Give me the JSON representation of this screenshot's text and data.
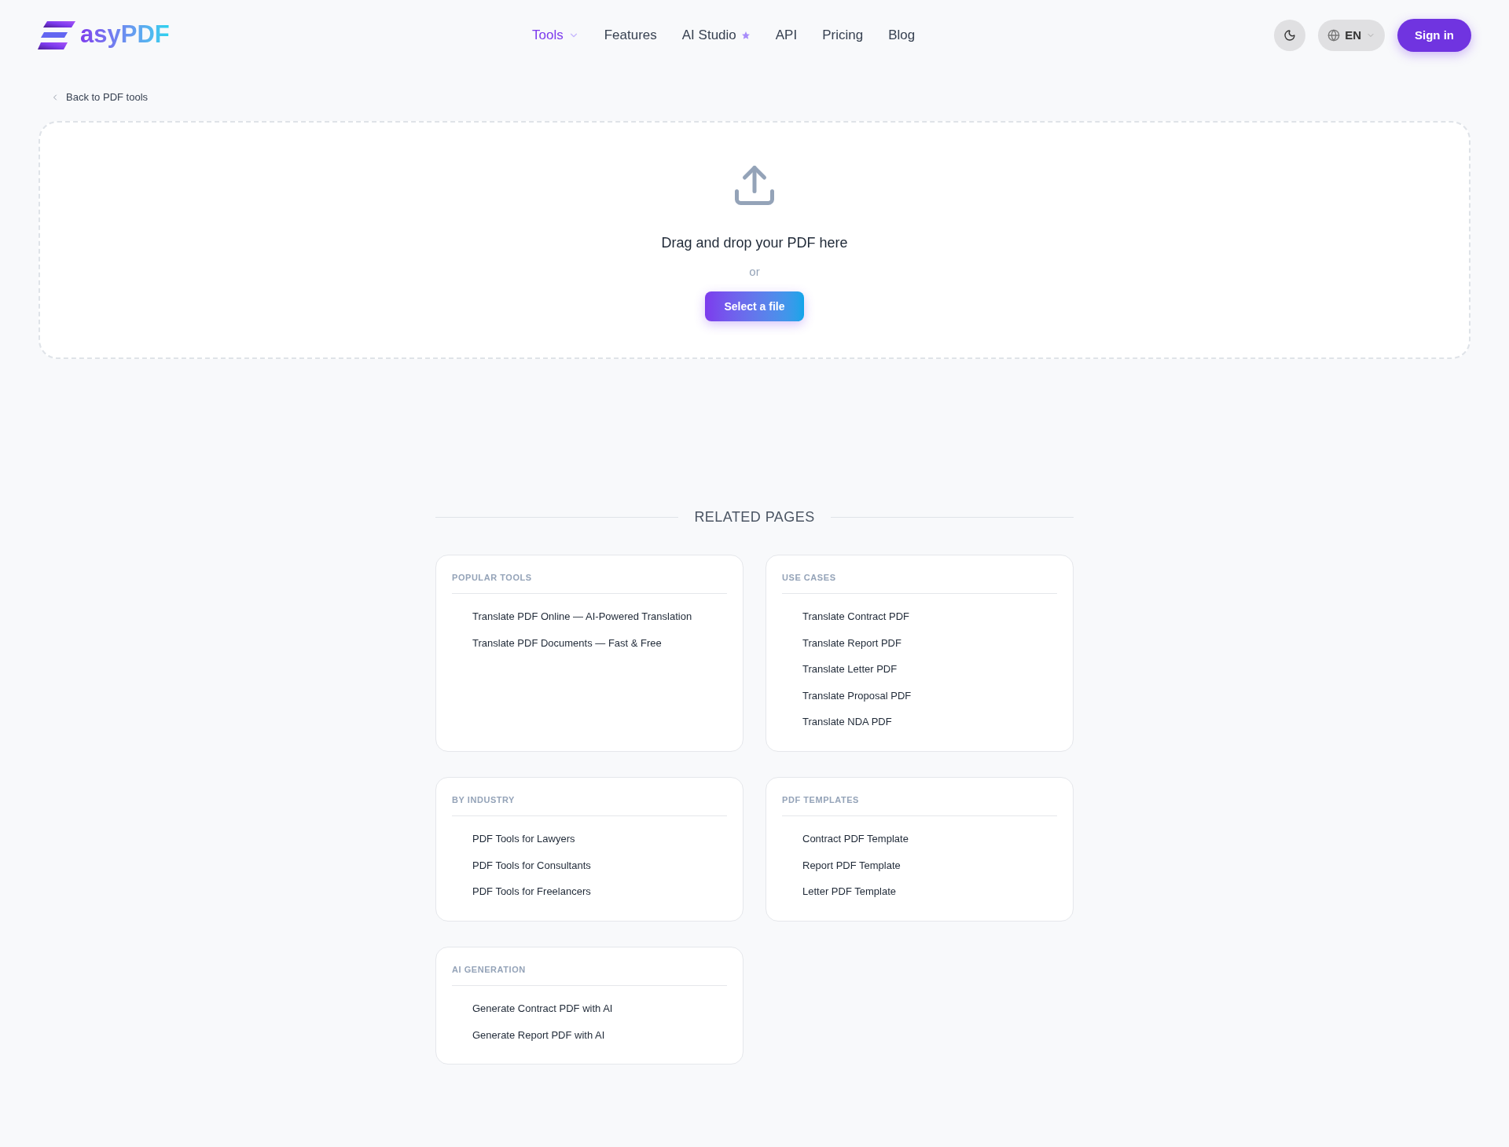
{
  "header": {
    "logo_text": "asyPDF",
    "nav": [
      {
        "label": "Tools",
        "selected": true,
        "kind": "dropdown"
      },
      {
        "label": "Features",
        "selected": false,
        "kind": "link"
      },
      {
        "label": "AI Studio",
        "selected": false,
        "kind": "starred"
      },
      {
        "label": "API",
        "selected": false,
        "kind": "link"
      },
      {
        "label": "Pricing",
        "selected": false,
        "kind": "link"
      },
      {
        "label": "Blog",
        "selected": false,
        "kind": "link"
      }
    ],
    "language": "EN",
    "sign_in": "Sign in"
  },
  "back_link": "Back to PDF tools",
  "upload": {
    "prompt": "Drag and drop your PDF here",
    "or": "or",
    "button": "Select a file"
  },
  "related": {
    "title": "RELATED PAGES",
    "sections": [
      {
        "title": "POPULAR TOOLS",
        "links": [
          "Translate PDF Online — AI-Powered Translation",
          "Translate PDF Documents — Fast & Free"
        ]
      },
      {
        "title": "USE CASES",
        "links": [
          "Translate Contract PDF",
          "Translate Report PDF",
          "Translate Letter PDF",
          "Translate Proposal PDF",
          "Translate NDA PDF"
        ]
      },
      {
        "title": "BY INDUSTRY",
        "links": [
          "PDF Tools for Lawyers",
          "PDF Tools for Consultants",
          "PDF Tools for Freelancers"
        ]
      },
      {
        "title": "PDF TEMPLATES",
        "links": [
          "Contract PDF Template",
          "Report PDF Template",
          "Letter PDF Template"
        ]
      },
      {
        "title": "AI GENERATION",
        "links": [
          "Generate Contract PDF with AI",
          "Generate Report PDF with AI"
        ]
      }
    ]
  }
}
